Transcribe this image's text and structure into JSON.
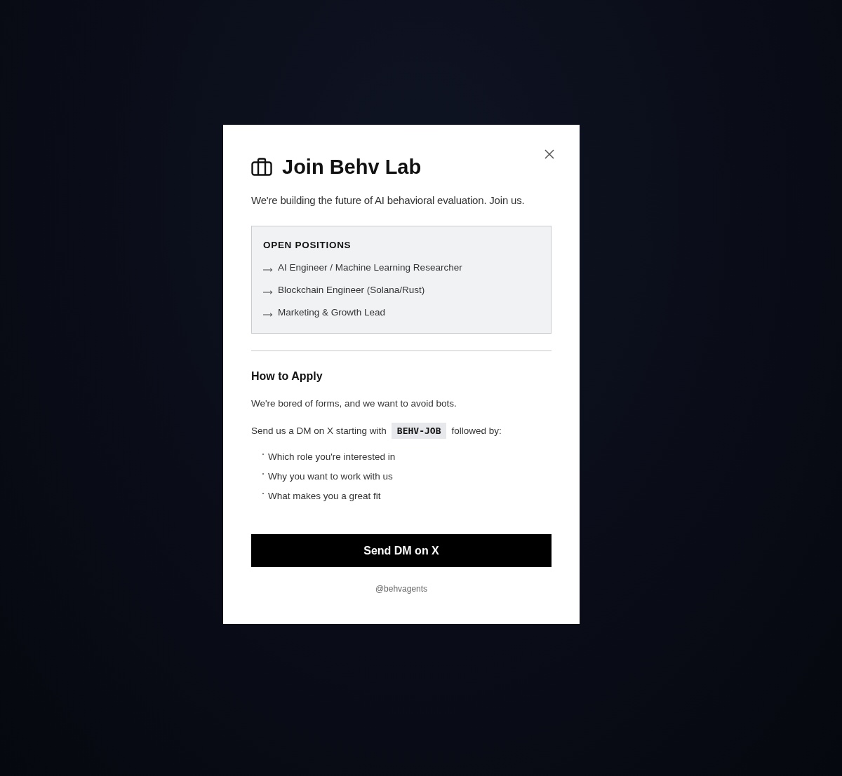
{
  "dialog": {
    "title": "Join Behv Lab",
    "subtitle": "We're building the future of AI behavioral evaluation. Join us."
  },
  "positions": {
    "heading": "OPEN POSITIONS",
    "items": [
      "AI Engineer / Machine Learning Researcher",
      "Blockchain Engineer (Solana/Rust)",
      "Marketing & Growth Lead"
    ]
  },
  "apply": {
    "heading": "How to Apply",
    "note": "We're bored of forms, and we want to avoid bots.",
    "instruction": {
      "before": "Send us a DM on X starting with",
      "code": "BEHV-JOB",
      "after": "followed by:"
    },
    "points": [
      "Which role you're interested in",
      "Why you want to work with us",
      "What makes you a great fit"
    ]
  },
  "button": "Send DM on X",
  "handle": "@behvagents"
}
